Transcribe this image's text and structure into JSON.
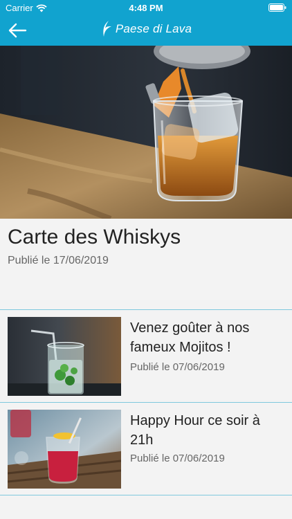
{
  "status_bar": {
    "carrier": "Carrier",
    "time": "4:48 PM"
  },
  "header": {
    "brand": "Paese di Lava",
    "color": "#11a3cf"
  },
  "featured": {
    "title": "Carte des Whiskys",
    "date": "Publié le 17/06/2019"
  },
  "news": [
    {
      "title": "Venez goûter à nos fameux Mojitos !",
      "date": "Publié le 07/06/2019"
    },
    {
      "title": "Happy Hour ce soir à 21h",
      "date": "Publié le 07/06/2019"
    }
  ],
  "icons": [
    "wifi-icon",
    "battery-icon",
    "back-arrow-icon",
    "brand-logo-icon"
  ]
}
